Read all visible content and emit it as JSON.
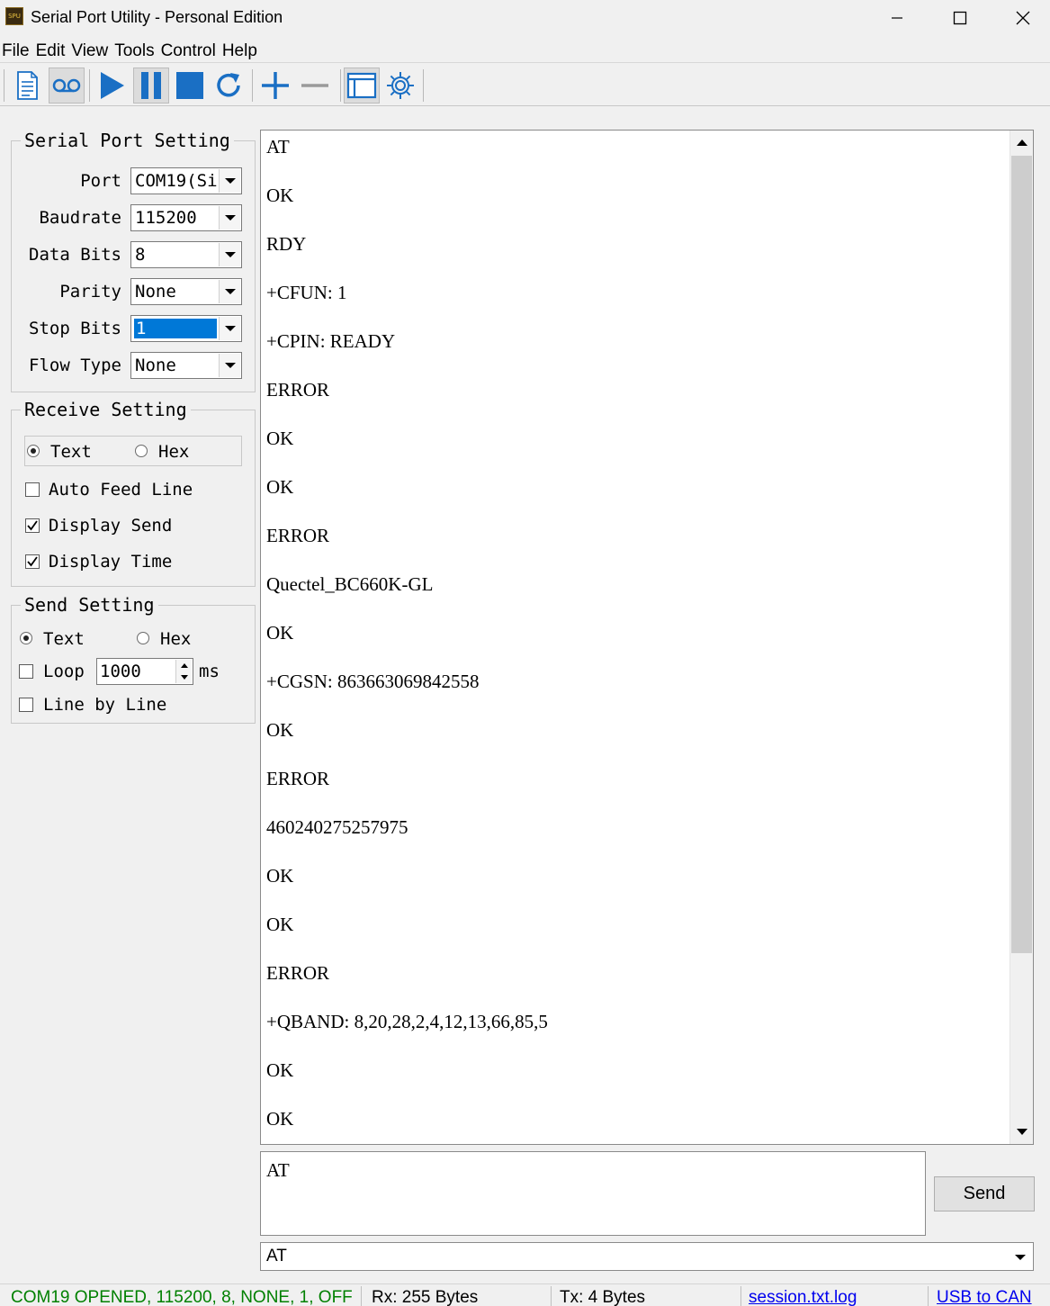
{
  "window": {
    "title": "Serial Port Utility - Personal Edition",
    "app_icon_text": "SPU"
  },
  "menu": [
    "File",
    "Edit",
    "View",
    "Tools",
    "Control",
    "Help"
  ],
  "serial_port_setting": {
    "title": "Serial Port Setting",
    "rows": [
      {
        "label": "Port",
        "value": "COM19(Si"
      },
      {
        "label": "Baudrate",
        "value": "115200"
      },
      {
        "label": "Data Bits",
        "value": "8"
      },
      {
        "label": "Parity",
        "value": "None"
      },
      {
        "label": "Stop Bits",
        "value": "1"
      },
      {
        "label": "Flow Type",
        "value": "None"
      }
    ]
  },
  "receive_setting": {
    "title": "Receive Setting",
    "text_label": "Text",
    "hex_label": "Hex",
    "auto_feed_line": "Auto Feed Line",
    "display_send": "Display Send",
    "display_time": "Display Time"
  },
  "send_setting": {
    "title": "Send Setting",
    "text_label": "Text",
    "hex_label": "Hex",
    "loop_label": "Loop",
    "loop_value": "1000",
    "loop_unit": "ms",
    "line_by_line": "Line by Line"
  },
  "receive_lines": [
    "AT",
    "OK",
    "RDY",
    "+CFUN: 1",
    "+CPIN: READY",
    "ERROR",
    "OK",
    "OK",
    "ERROR",
    "Quectel_BC660K-GL",
    "OK",
    "+CGSN: 863663069842558",
    "OK",
    "ERROR",
    "460240275257975",
    "OK",
    "OK",
    "ERROR",
    "+QBAND: 8,20,28,2,4,12,13,66,85,5",
    "OK",
    "OK"
  ],
  "send": {
    "text": "AT",
    "button": "Send",
    "history_value": "AT"
  },
  "status": {
    "connection": "COM19 OPENED, 115200, 8, NONE, 1, OFF",
    "rx": "Rx: 255 Bytes",
    "tx": "Tx: 4 Bytes",
    "log_file": "session.txt.log",
    "usb_to_can": "USB to CAN"
  },
  "colors": {
    "status_green": "#008000",
    "selection_blue": "#0078d7",
    "icon_blue": "#1a6fc4",
    "link_blue": "#0000ee"
  }
}
